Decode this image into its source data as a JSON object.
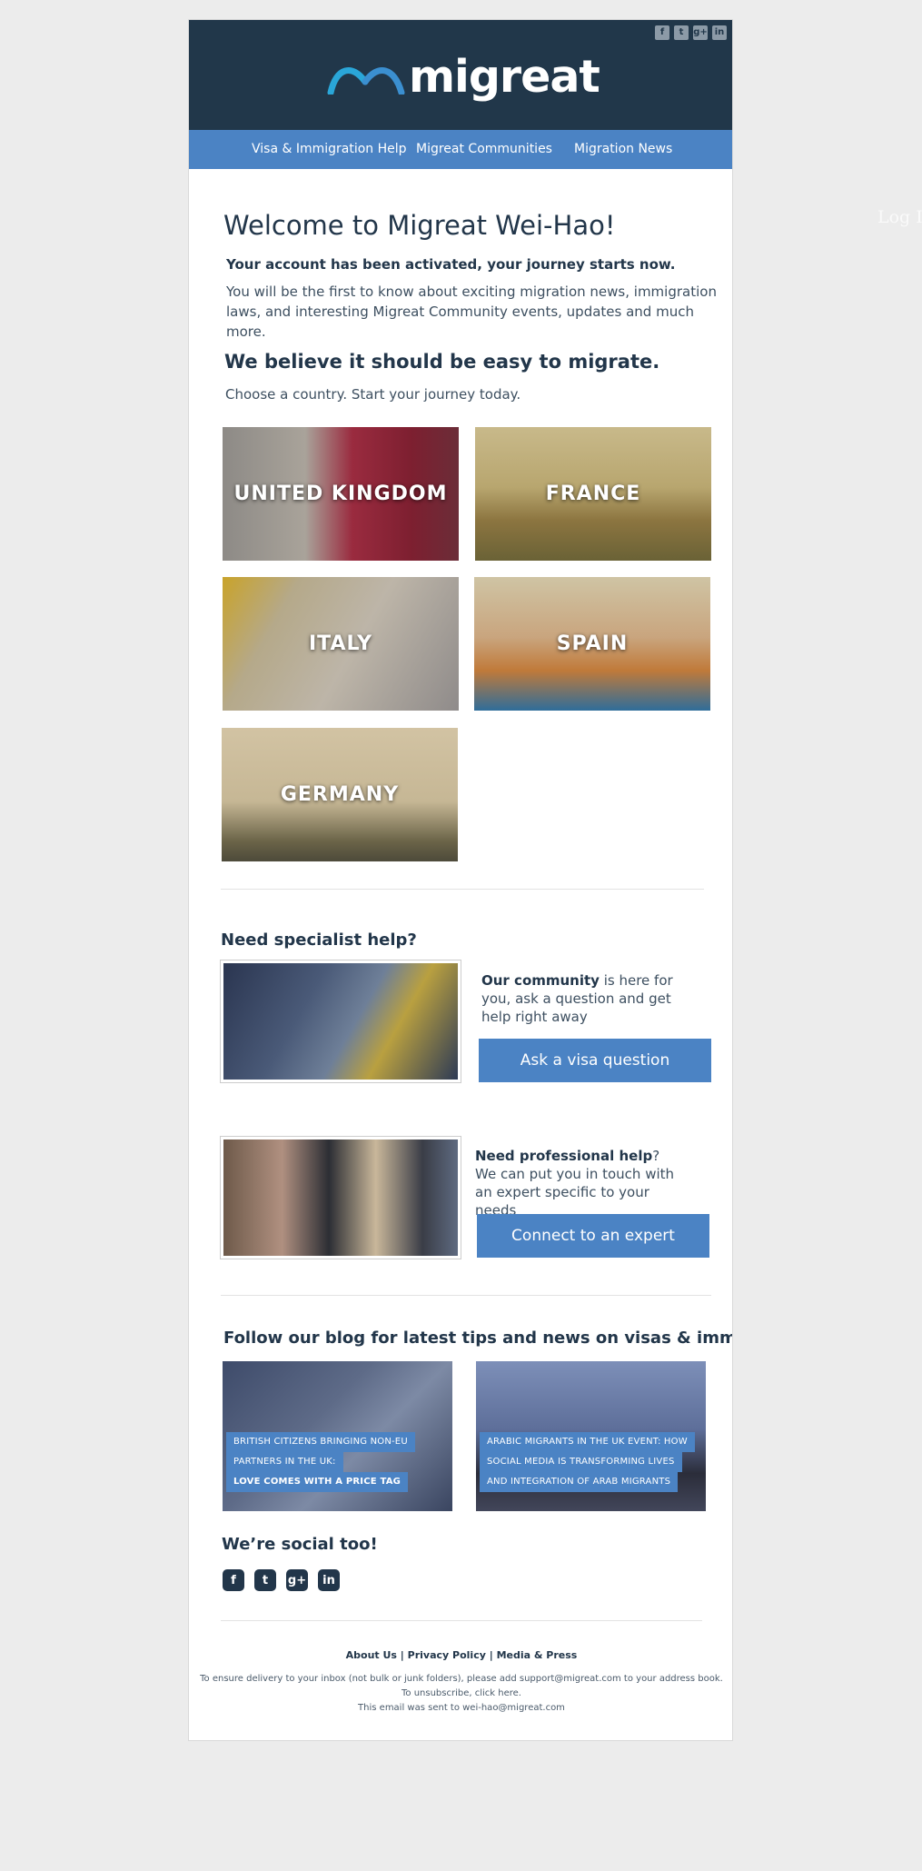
{
  "login_ghost": "Log In",
  "header": {
    "logo_text": "migreat",
    "social_icons": [
      {
        "name": "facebook-icon",
        "glyph": "f"
      },
      {
        "name": "twitter-icon",
        "glyph": "t"
      },
      {
        "name": "google-plus-icon",
        "glyph": "g+"
      },
      {
        "name": "linkedin-icon",
        "glyph": "in"
      }
    ]
  },
  "nav": {
    "items": [
      "Visa & Immigration Help",
      "Migreat Communities",
      "Migration News"
    ]
  },
  "welcome": {
    "title": "Welcome to Migreat Wei-Hao!",
    "activated": "Your account has been activated, your journey starts now.",
    "intro": "You will be the first to know about exciting migration news, immigration laws, and interesting Migreat Community events, updates and much more."
  },
  "countries_section": {
    "title": "We believe it should be easy to migrate.",
    "subtitle": "Choose a country. Start your journey today.",
    "countries": [
      "UNITED KINGDOM",
      "FRANCE",
      "ITALY",
      "SPAIN",
      "GERMANY"
    ]
  },
  "help": {
    "title": "Need specialist help?",
    "community": {
      "bold": "Our community",
      "rest": " is here for you, ask a question and get help right away",
      "button": "Ask a visa question"
    },
    "professional": {
      "bold": "Need professional help",
      "rest": "? We can put you in touch with an expert specific to your needs",
      "button": "Connect to an expert"
    }
  },
  "blog": {
    "title": "Follow our blog for latest tips and news on visas & immigration",
    "posts": [
      {
        "lines": [
          "BRITISH CITIZENS BRINGING NON-EU",
          "PARTNERS IN THE UK:",
          "LOVE COMES WITH A PRICE TAG"
        ]
      },
      {
        "lines": [
          "ARABIC MIGRANTS IN THE UK EVENT: HOW",
          "SOCIAL MEDIA IS TRANSFORMING LIVES",
          "AND INTEGRATION OF ARAB MIGRANTS"
        ]
      }
    ]
  },
  "social": {
    "title": "We’re social too!",
    "icons": [
      {
        "name": "facebook-icon",
        "glyph": "f"
      },
      {
        "name": "twitter-icon",
        "glyph": "t"
      },
      {
        "name": "google-plus-icon",
        "glyph": "g+"
      },
      {
        "name": "linkedin-icon",
        "glyph": "in"
      }
    ]
  },
  "footer": {
    "links": [
      "About Us",
      "Privacy Policy",
      "Media & Press"
    ],
    "separator": " | ",
    "delivery": "To ensure delivery to your inbox (not bulk or junk folders), please add support@migreat.com to your address book.",
    "unsubscribe_prefix": "To unsubscribe, ",
    "unsubscribe_link": "click here",
    "unsubscribe_suffix": ".",
    "sent_to": "This email was sent to wei-hao@migreat.com"
  },
  "colors": {
    "header_bg": "#21374a",
    "accent_blue": "#4b83c4",
    "page_bg": "#ececec",
    "text_dark": "#22364a"
  }
}
